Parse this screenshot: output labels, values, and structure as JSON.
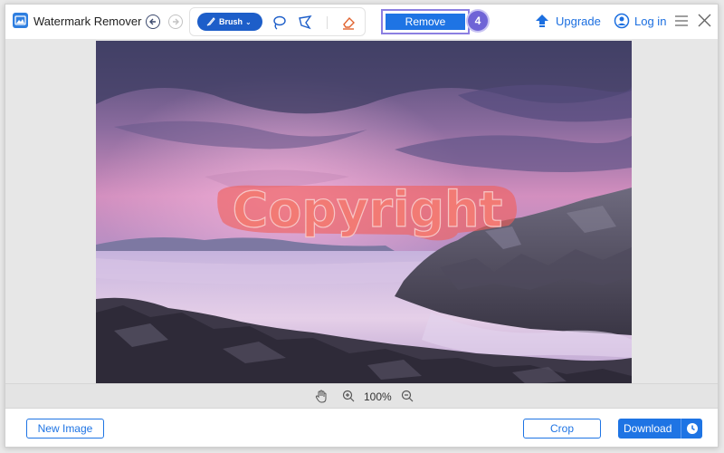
{
  "app": {
    "title": "Watermark Remover"
  },
  "toolbar": {
    "brush_label": "Brush",
    "remove_label": "Remove",
    "step_badge": "4",
    "upgrade_label": "Upgrade",
    "login_label": "Log in"
  },
  "canvas": {
    "watermark_text": "Copyright",
    "zoom": "100%"
  },
  "footer": {
    "new_image_label": "New Image",
    "crop_label": "Crop",
    "download_label": "Download"
  },
  "colors": {
    "accent": "#1e74e4",
    "brush_button": "#1d5ec9",
    "step_badge": "#6f64d6",
    "watermark_mask": "#f0605a"
  },
  "icons": [
    "app-logo-icon",
    "undo-icon",
    "redo-icon",
    "brush-icon",
    "chevron-down-icon",
    "lasso-icon",
    "polygon-lasso-icon",
    "eraser-icon",
    "upgrade-arrow-icon",
    "user-icon",
    "menu-icon",
    "close-icon",
    "hand-icon",
    "zoom-in-icon",
    "zoom-out-icon",
    "clock-icon"
  ]
}
